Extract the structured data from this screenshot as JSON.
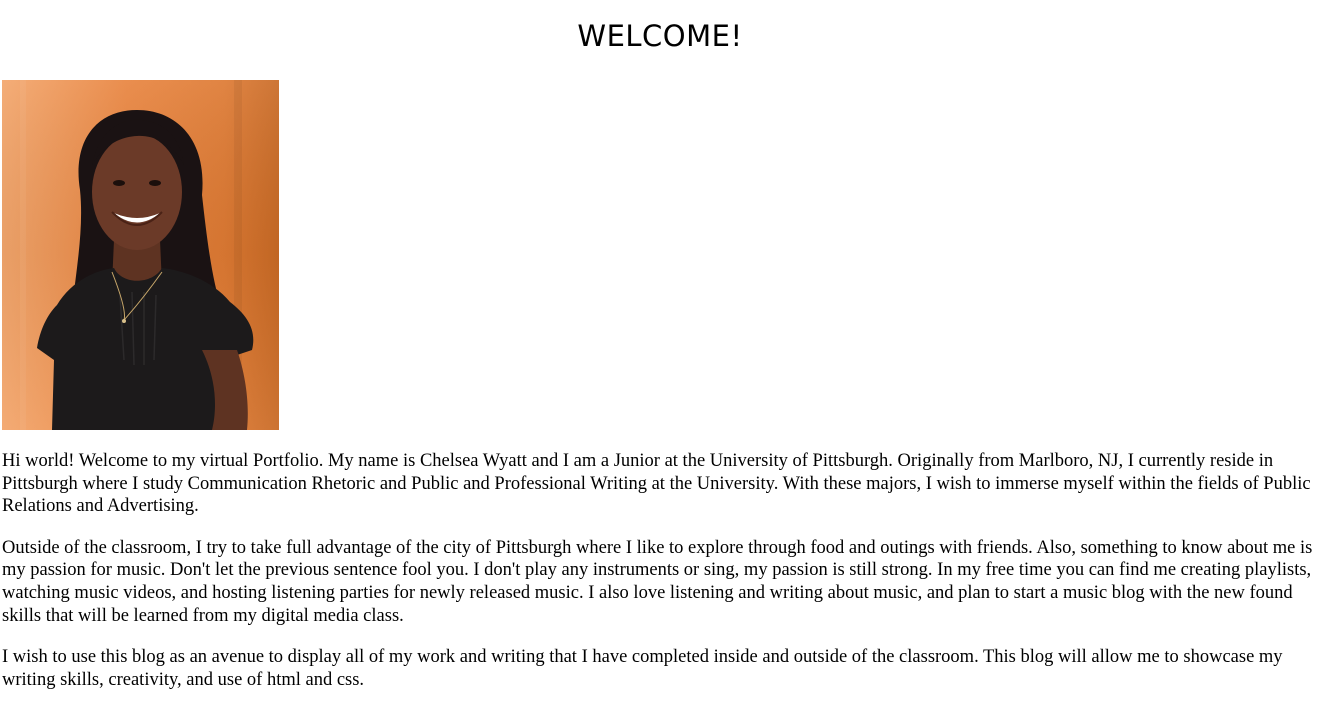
{
  "header": {
    "title": "WELCOME!"
  },
  "photo": {
    "icon": "portrait-photo",
    "colors": {
      "background": "#e3833e",
      "background_light": "#f2a468",
      "shirt": "#1c1a1b",
      "hair": "#1a1213",
      "skin": "#6b3a28"
    }
  },
  "main": {
    "paragraphs": [
      "Hi world! Welcome to my virtual Portfolio. My name is Chelsea Wyatt and I am a Junior at the University of Pittsburgh. Originally from Marlboro, NJ, I currently reside in Pittsburgh where I study Communication Rhetoric and Public and Professional Writing at the University. With these majors, I wish to immerse myself within the fields of Public Relations and Advertising.",
      "Outside of the classroom, I try to take full advantage of the city of Pittsburgh where I like to explore through food and outings with friends. Also, something to know about me is my passion for music. Don't let the previous sentence fool you. I don't play any instruments or sing, my passion is still strong. In my free time you can find me creating playlists, watching music videos, and hosting listening parties for newly released music. I also love listening and writing about music, and plan to start a music blog with the new found skills that will be learned from my digital media class.",
      "I wish to use this blog as an avenue to display all of my work and writing that I have completed inside and outside of the classroom. This blog will allow me to showcase my writing skills, creativity, and use of html and css."
    ]
  }
}
